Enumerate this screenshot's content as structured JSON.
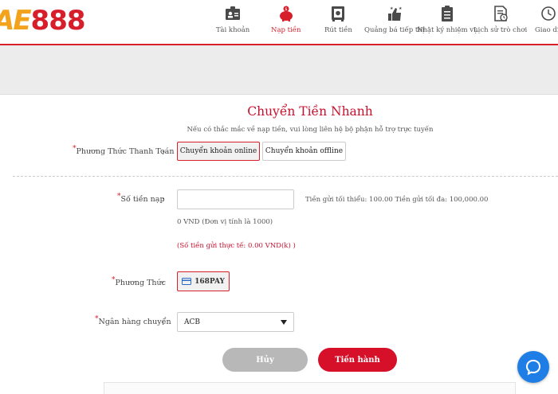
{
  "brand": {
    "logo_text_a": "AE",
    "logo_text_b": "888"
  },
  "nav": [
    {
      "label": "Tài khoản",
      "icon": "id-card-icon"
    },
    {
      "label": "Nạp tiền",
      "icon": "piggy-bank-icon",
      "active": true
    },
    {
      "label": "Rút tiền",
      "icon": "safe-icon"
    },
    {
      "label": "Quảng bá tiếp thị",
      "icon": "thumbs-up-icon"
    },
    {
      "label": "Nhật ký nhiệm vụ",
      "icon": "clipboard-icon"
    },
    {
      "label": "Lịch sử trò chơi",
      "icon": "history-document-icon"
    },
    {
      "label": "Giao dịch",
      "icon": "clock-icon"
    }
  ],
  "page": {
    "title": "Chuyển Tiền Nhanh",
    "subtitle": "Nếu có thắc mắc về nạp tiền, vui lòng liên hệ bộ phận hỗ trợ trực tuyến"
  },
  "form": {
    "method_label": "Phương Thức Thanh Toán",
    "method_options": [
      "Chuyển khoản online",
      "Chuyển khoản offline"
    ],
    "amount_label": "Số tiền nạp",
    "amount_value": "",
    "amount_limits": "Tiền gửi tối thiểu: 100.00 Tiền gửi tối đa: 100,000.00",
    "amount_unit_note": "0 VND (Đơn vị tính là 1000)",
    "actual_deposit": "(Số tiền gửi thực tế: 0.00 VND(k) )",
    "channel_label": "Phương Thức",
    "channel_value": "168PAY",
    "bank_label": "Ngân hàng chuyển",
    "bank_value": "ACB",
    "colon": ":",
    "required_mark": "*"
  },
  "actions": {
    "cancel": "Hủy",
    "submit": "Tiến hành"
  },
  "colors": {
    "accent": "#d71e2b",
    "cancel_gray": "#b8b8b8",
    "chat_blue": "#1e7ee6"
  }
}
